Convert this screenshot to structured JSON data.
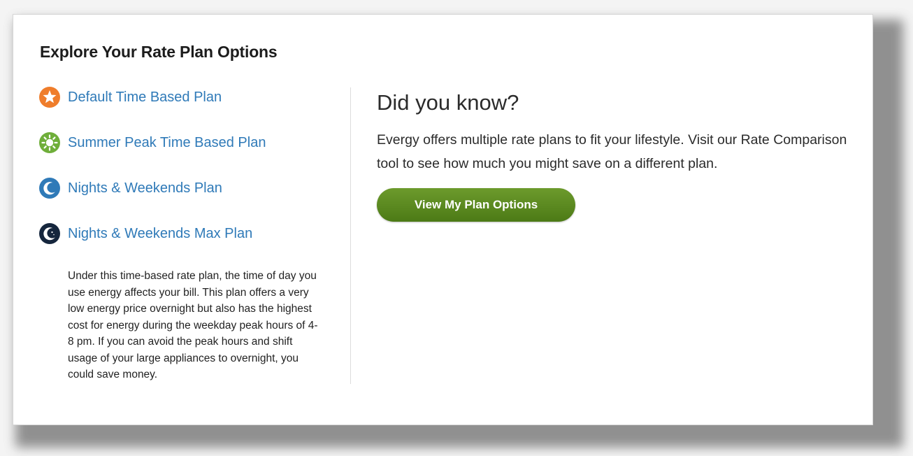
{
  "card": {
    "title": "Explore Your Rate Plan Options"
  },
  "plans": [
    {
      "label": "Default Time Based Plan",
      "icon": "star-icon",
      "color": "#ef7d2b"
    },
    {
      "label": "Summer Peak Time Based Plan",
      "icon": "sun-icon",
      "color": "#6fae3a"
    },
    {
      "label": "Nights & Weekends Plan",
      "icon": "moon-icon",
      "color": "#2f7ab8"
    },
    {
      "label": "Nights & Weekends Max Plan",
      "icon": "moon-stars-icon",
      "color": "#15263d"
    }
  ],
  "selected_plan": {
    "description": "Under this time-based rate plan, the time of day you use energy affects your bill. This plan offers a very low energy price overnight but also has the highest cost for energy during the weekday peak hours of 4-8 pm. If you can avoid the peak hours and shift usage of your large appliances to overnight, you could save money."
  },
  "did_you_know": {
    "title": "Did you know?",
    "body": "Evergy offers multiple rate plans to fit your lifestyle. Visit our Rate Comparison tool to see how much you might save on a different plan.",
    "button_label": "View My Plan Options"
  },
  "colors": {
    "link": "#2f7ab8",
    "button": "#5b8a21"
  }
}
